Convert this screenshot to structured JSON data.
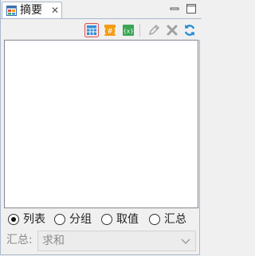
{
  "tab": {
    "title": "摘要",
    "close_glyph": "✕",
    "icon": "summary-table-icon"
  },
  "window": {
    "minimize_icon": "minimize-icon",
    "maximize_icon": "maximize-icon"
  },
  "toolbar": {
    "buttons": [
      {
        "name": "list-view-button",
        "icon": "table-icon",
        "color": "#2f8fd8",
        "active": true
      },
      {
        "name": "group-field-button",
        "icon": "hash-field-icon",
        "color": "#f39c12"
      },
      {
        "name": "value-field-button",
        "icon": "variable-field-icon",
        "color": "#3aa655"
      },
      {
        "name": "edit-button",
        "icon": "pencil-icon",
        "color": "#a0a0a0"
      },
      {
        "name": "delete-button",
        "icon": "delete-x-icon",
        "color": "#a0a0a0"
      },
      {
        "name": "refresh-button",
        "icon": "refresh-icon",
        "color": "#1e88d8"
      }
    ]
  },
  "modes": {
    "selected": "list",
    "options": [
      {
        "id": "list",
        "label": "列表"
      },
      {
        "id": "group",
        "label": "分组"
      },
      {
        "id": "value",
        "label": "取值"
      },
      {
        "id": "summary",
        "label": "汇总"
      }
    ]
  },
  "summary": {
    "label": "汇总:",
    "value": "求和",
    "disabled": true
  }
}
